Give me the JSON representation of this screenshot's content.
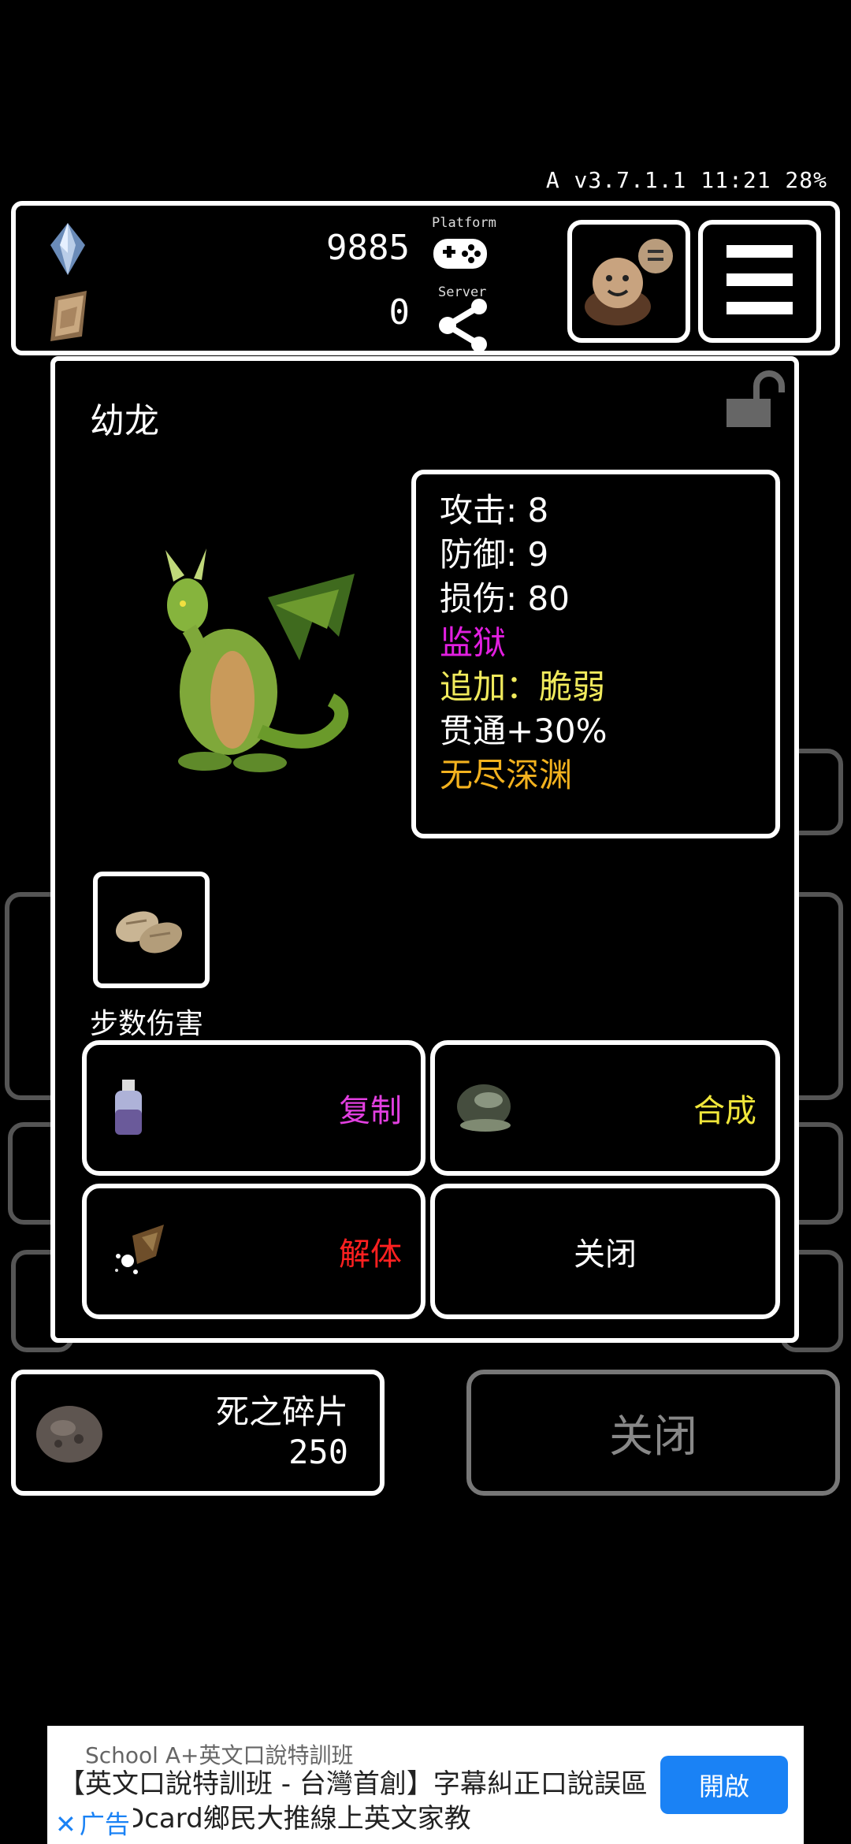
{
  "status_bar": {
    "text": "A v3.7.1.1 11:21 28%"
  },
  "topbar": {
    "crystal_count": "9885",
    "card_count": "0",
    "platform_label": "Platform",
    "server_label": "Server"
  },
  "modal": {
    "title": "幼龙",
    "stats": [
      {
        "text": "攻击: 8",
        "color": "#ffffff"
      },
      {
        "text": "防御: 9",
        "color": "#ffffff"
      },
      {
        "text": "损伤: 80",
        "color": "#ffffff"
      },
      {
        "text": "监狱",
        "color": "#e21fe0"
      },
      {
        "text": "追加：脆弱",
        "color": "#f0ea5c"
      },
      {
        "text": "贯通+30%",
        "color": "#ffffff"
      },
      {
        "text": "无尽深渊",
        "color": "#f3b21e"
      }
    ],
    "skill_label": "步数伤害",
    "actions": {
      "copy": "复制",
      "synth": "合成",
      "dismantle": "解体",
      "close": "关闭"
    },
    "action_colors": {
      "copy": "#e23fe0",
      "synth": "#f0e63a",
      "dismantle": "#ff2020",
      "close": "#ffffff"
    }
  },
  "bottom": {
    "shard_name": "死之碎片",
    "shard_count": "250",
    "close_label": "关闭"
  },
  "ad": {
    "source": "School A+英文口說特訓班",
    "text": "【英文口說特訓班 - 台灣首創】字幕糾正口說誤區 PTT, Dcard鄉民大推線上英文家教",
    "button": "開啟",
    "tag": "广告"
  }
}
